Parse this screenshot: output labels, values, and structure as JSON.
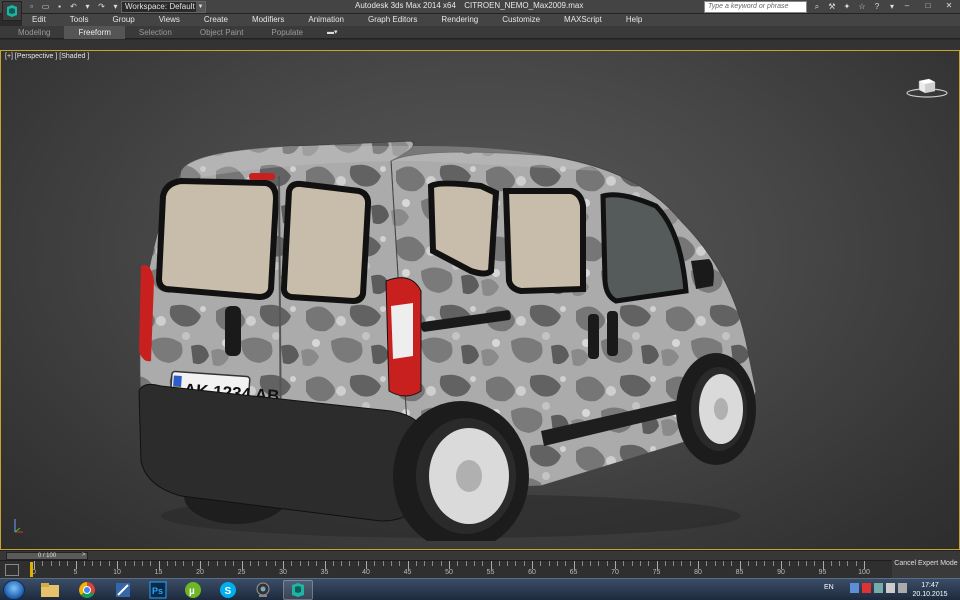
{
  "titlebar": {
    "workspace": "Workspace: Default",
    "app_name": "Autodesk 3ds Max  2014 x64",
    "file_name": "CITROEN_NEMO_Max2009.max",
    "search_placeholder": "Type a keyword or phrase"
  },
  "menu": {
    "items": [
      "Edit",
      "Tools",
      "Group",
      "Views",
      "Create",
      "Modifiers",
      "Animation",
      "Graph Editors",
      "Rendering",
      "Customize",
      "MAXScript",
      "Help"
    ]
  },
  "ribbon": {
    "tabs": [
      "Modeling",
      "Freeform",
      "Selection",
      "Object Paint",
      "Populate"
    ],
    "active_tab": "Freeform"
  },
  "viewport": {
    "label": "[+] [Perspective ] [Shaded ]",
    "license_plate": "AK 1234 AB",
    "colors": {
      "camo_base": "#a9a9a9",
      "camo_dark": "#6b6b6b",
      "glass": "#c9bfae",
      "bumper": "#2c2c2c",
      "taillight": "#c8201e",
      "selection_border": "#c8a332"
    }
  },
  "timeline": {
    "frame_display": "0 / 100"
  },
  "trackbar": {
    "labels": [
      "0",
      "5",
      "10",
      "15",
      "20",
      "25",
      "30",
      "35",
      "40",
      "45",
      "50",
      "55",
      "60",
      "65",
      "70",
      "75",
      "80",
      "85",
      "90",
      "95",
      "100"
    ],
    "expert_mode_label": "Cancel Expert Mode"
  },
  "taskbar": {
    "apps": [
      "start-menu",
      "file-explorer",
      "chrome",
      "media-app",
      "photoshop",
      "utorrent",
      "skype",
      "webcam",
      "3ds-max"
    ],
    "active_app": "3ds-max",
    "language": "EN",
    "time": "17:47",
    "date": "20.10.2015"
  }
}
